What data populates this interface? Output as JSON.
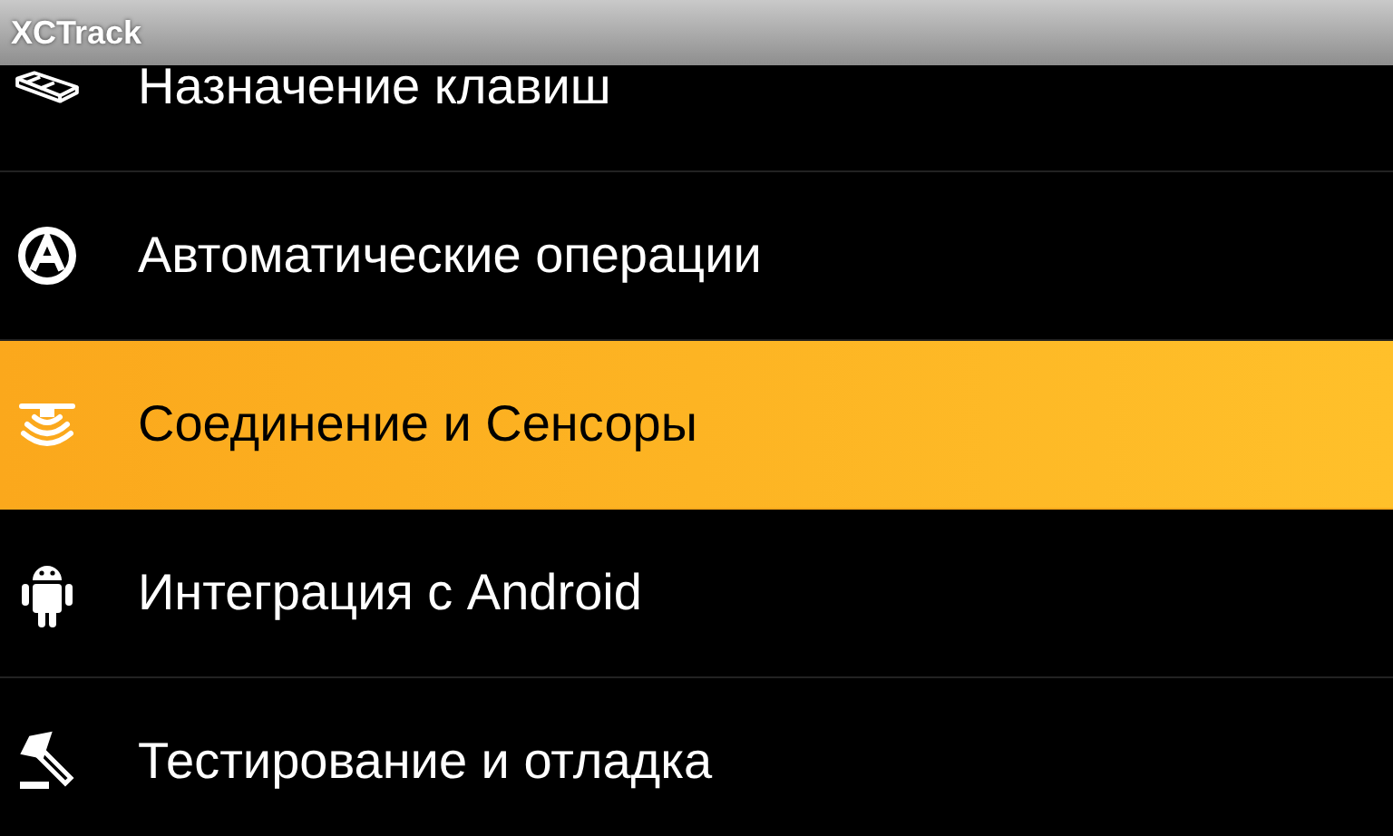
{
  "window": {
    "title": "XCTrack"
  },
  "menu": {
    "items": [
      {
        "kind": "keys",
        "label": "Назначение клавиш",
        "selected": false
      },
      {
        "kind": "auto",
        "label": "Автоматические операции",
        "selected": false
      },
      {
        "kind": "sensor",
        "label": "Соединение и Сенсоры",
        "selected": true
      },
      {
        "kind": "android",
        "label": "Интеграция с Android",
        "selected": false
      },
      {
        "kind": "debug",
        "label": "Тестирование и отладка",
        "selected": false
      }
    ]
  }
}
